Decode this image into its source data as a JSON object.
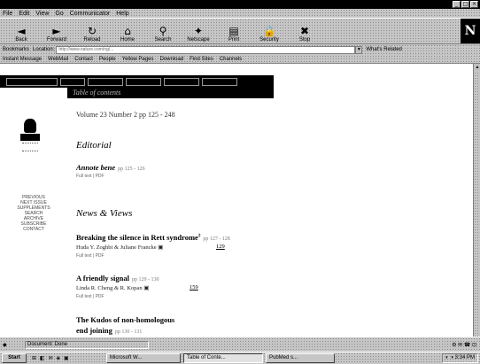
{
  "window": {
    "buttons": [
      "_",
      "□",
      "×"
    ]
  },
  "menu": [
    "File",
    "Edit",
    "View",
    "Go",
    "Communicator",
    "Help"
  ],
  "toolbar": [
    {
      "label": "Back",
      "icon": "back-arrow-icon",
      "glyph": "◄"
    },
    {
      "label": "Forward",
      "icon": "forward-arrow-icon",
      "glyph": "►"
    },
    {
      "label": "Reload",
      "icon": "reload-icon",
      "glyph": "↻"
    },
    {
      "label": "Home",
      "icon": "home-icon",
      "glyph": "⌂"
    },
    {
      "label": "Search",
      "icon": "search-icon",
      "glyph": "⚲"
    },
    {
      "label": "Netscape",
      "icon": "netscape-icon",
      "glyph": "✦"
    },
    {
      "label": "Print",
      "icon": "print-icon",
      "glyph": "▤"
    },
    {
      "label": "Security",
      "icon": "lock-icon",
      "glyph": "🔒"
    },
    {
      "label": "Stop",
      "icon": "stop-icon",
      "glyph": "✖"
    }
  ],
  "brand": "N",
  "locbar": {
    "bookmarks": "Bookmarks",
    "location_label": "Location:",
    "location_value": "http://www.nature.com/ng/...",
    "whats_related": "What's Related"
  },
  "personal": [
    "Instant Message",
    "WebMail",
    "Contact",
    "People",
    "Yellow Pages",
    "Download",
    "Find Sites",
    "Channels"
  ],
  "page": {
    "title_strip": "Table of contents",
    "volume": "Volume 23 Number 2 pp 125 - 248",
    "editorial_heading": "Editorial",
    "news_heading": "News & Views",
    "left_nav": [
      "PREVIOUS",
      "NEXT ISSUE",
      "SUPPLEMENTS",
      "SEARCH",
      "ARCHIVE",
      "SUBSCRIBE",
      "CONTACT"
    ]
  },
  "articles": {
    "a1": {
      "title": "Annote bene",
      "pages": "pp 125 - 126",
      "sub": "Full text | PDF"
    },
    "a2": {
      "title": "Breaking the silence in Rett syndrome",
      "pages": "pp 127 - 128",
      "authors": "Huda Y. Zoghbi & Juliane Francke",
      "page_ref": "129",
      "sub": "Full text | PDF"
    },
    "a3": {
      "title": "A friendly signal",
      "pages": "pp 129 - 130",
      "authors": "Linda R. Cheng & R. Kopan",
      "page_ref": "159",
      "sub": "Full text | PDF"
    },
    "a4": {
      "title_line1": "The Kudos of non-homologous",
      "title_line2": "end joining",
      "pages": "pp 130 - 131"
    }
  },
  "status": {
    "text": "Document: Done",
    "right": "⚙ ✉ ☎ ⊡"
  },
  "taskbar": {
    "start": "Start",
    "quicklaunch": "⊞ ◧ ✉ ◈ ▣",
    "tasks": [
      {
        "label": "Microsoft W...",
        "active": false
      },
      {
        "label": "Table of Conte...",
        "active": true
      },
      {
        "label": "PubMed s...",
        "active": false
      }
    ],
    "tray": "◐ ◑ 3:34 PM"
  }
}
